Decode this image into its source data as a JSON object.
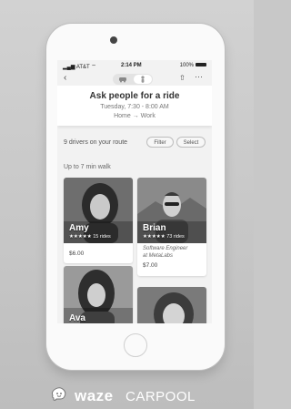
{
  "status_bar": {
    "carrier": "AT&T",
    "time": "2:14 PM",
    "battery": "100%"
  },
  "nav": {
    "back_glyph": "‹",
    "share_glyph": "⇧",
    "more_glyph": "···",
    "segments": [
      "car-icon",
      "person-icon"
    ],
    "selected_segment": 1
  },
  "header": {
    "title": "Ask people for a ride",
    "schedule": "Tuesday, 7:30 - 8:00 AM",
    "route": "Home → Work"
  },
  "drivers": {
    "count_text": "9 drivers on your route",
    "filter_label": "Filter",
    "select_label": "Select"
  },
  "section": {
    "walk_label": "Up to 7 min walk"
  },
  "cards": [
    {
      "name": "Amy",
      "stars": "★★★★★",
      "rides": "15 rides",
      "price": "$6.00"
    },
    {
      "name": "Brian",
      "stars": "★★★★★",
      "rides": "73 rides",
      "job": "Software Engineer",
      "company": "at MetaLabs",
      "price": "$7.00"
    },
    {
      "name": "Ava"
    },
    {
      "name": ""
    }
  ],
  "footer": {
    "brand": "waze",
    "product": "CARPOOL"
  }
}
